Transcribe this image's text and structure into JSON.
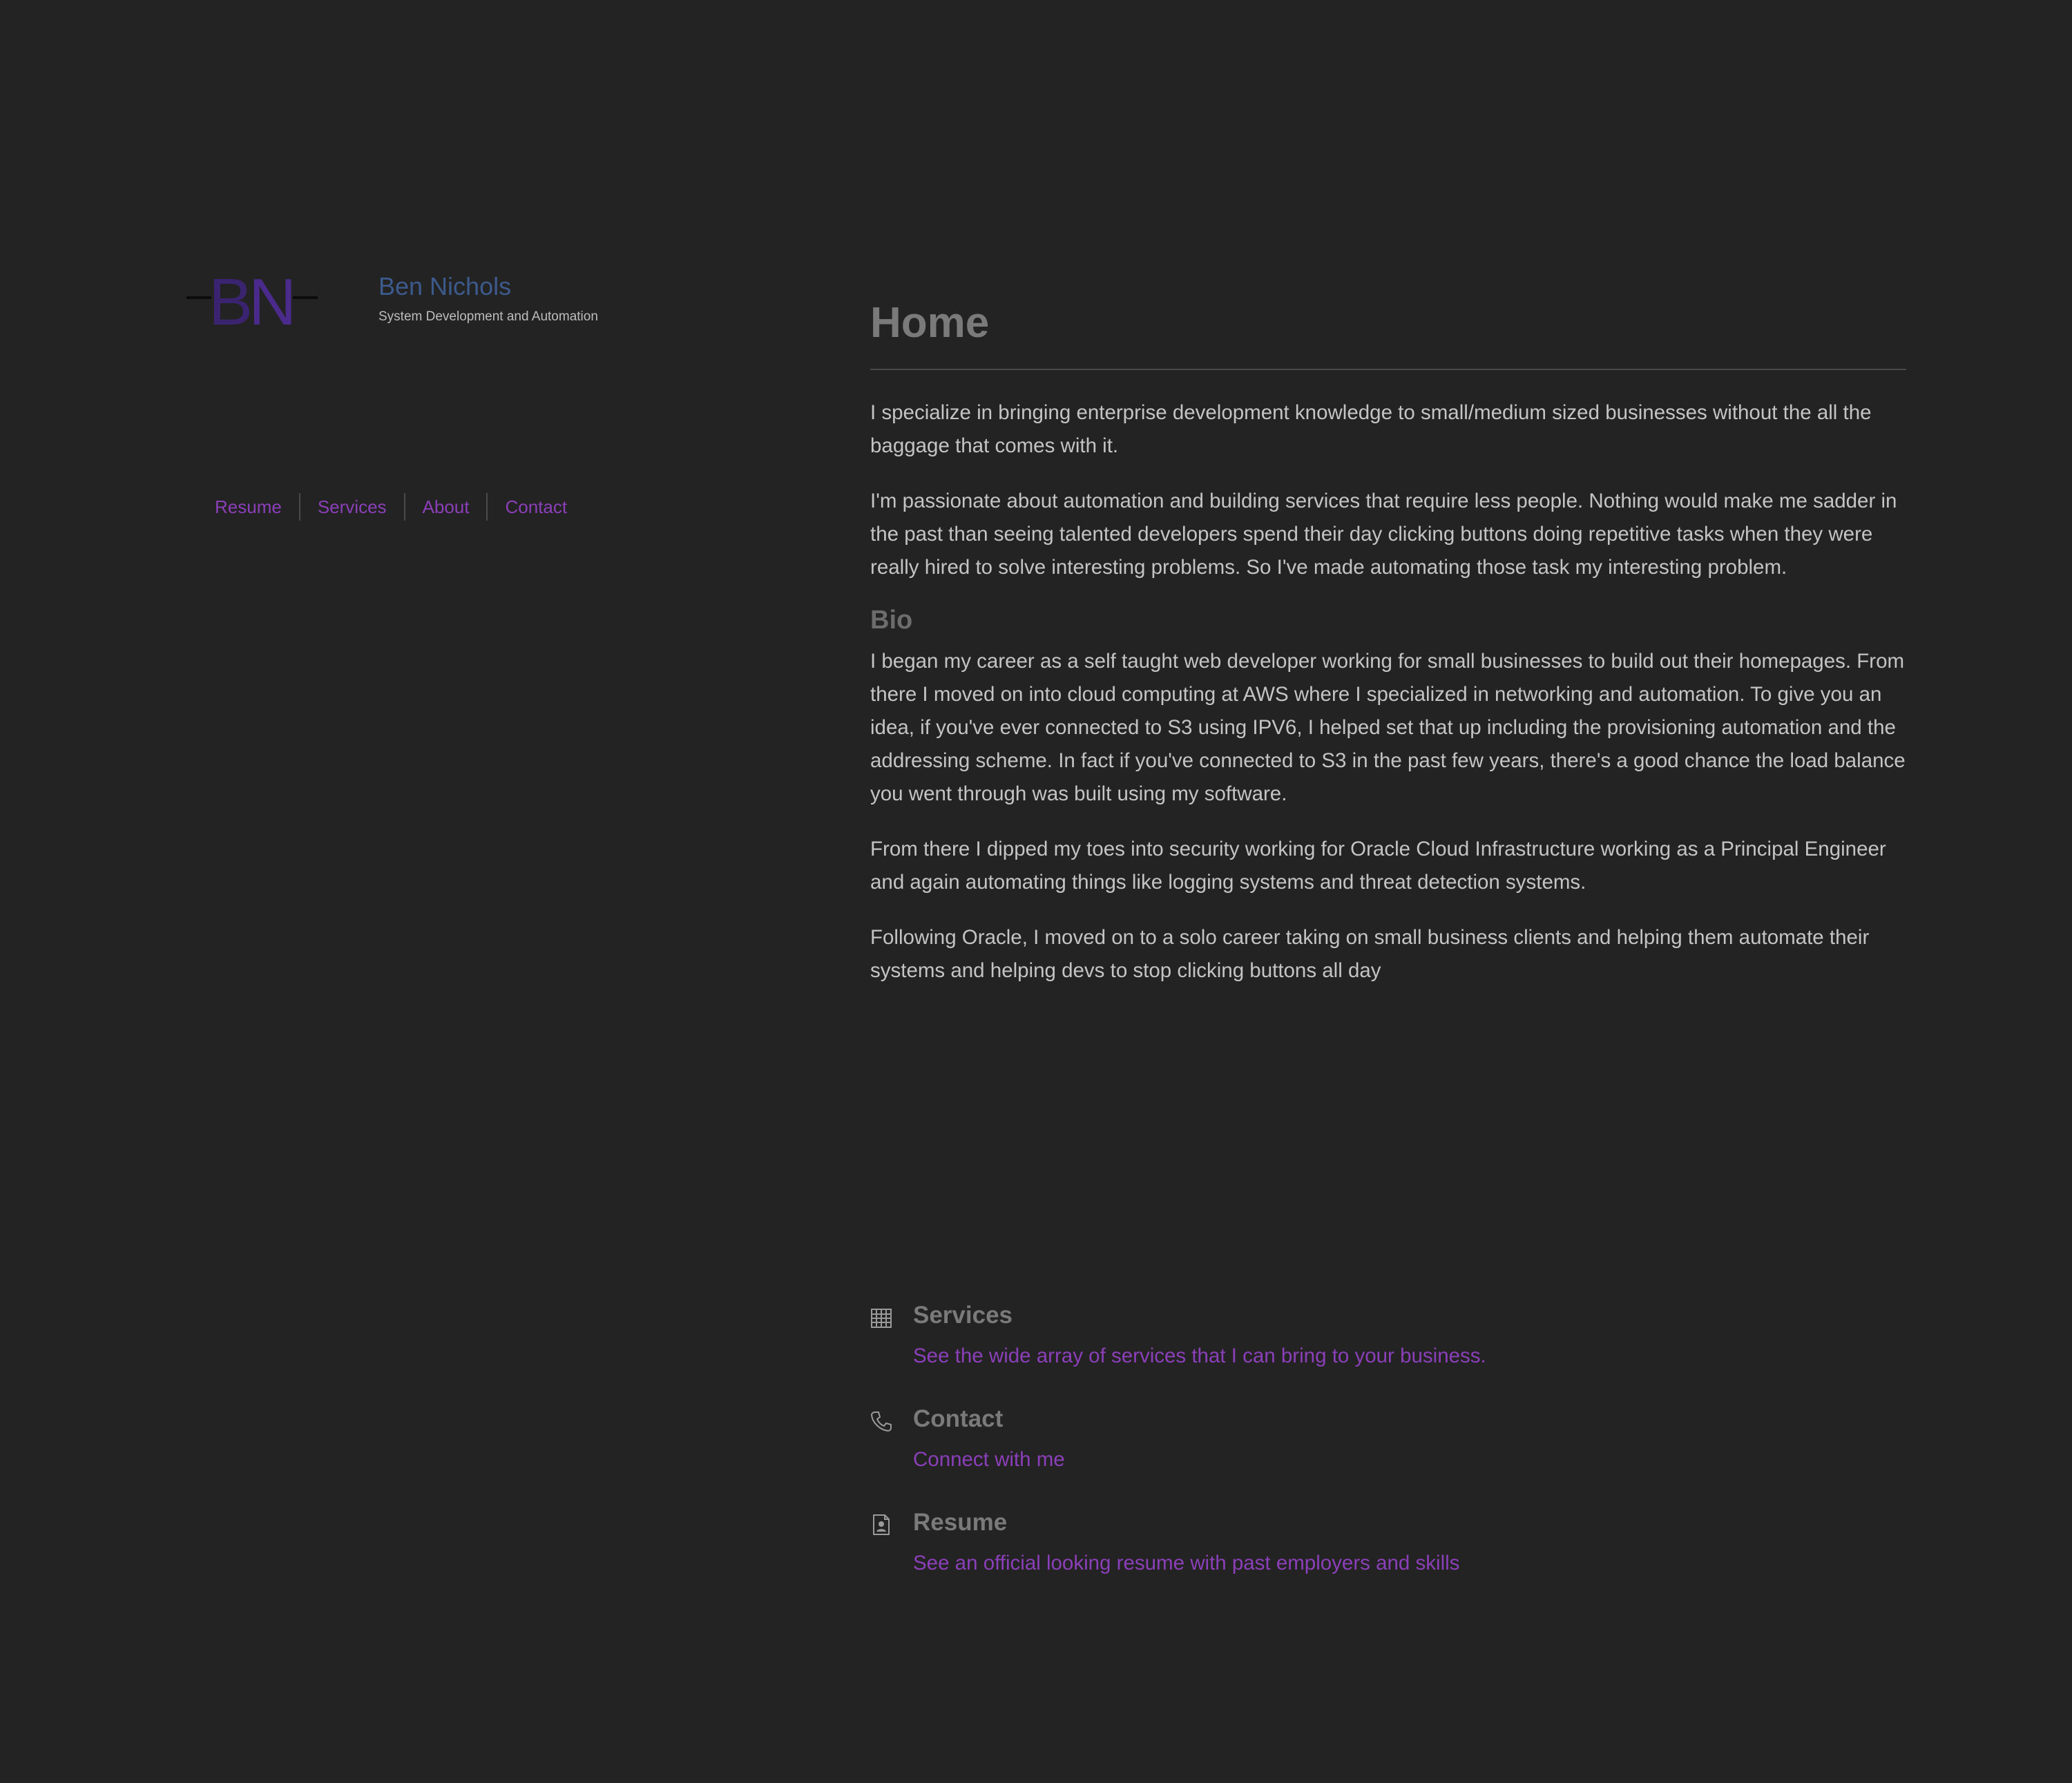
{
  "brand": {
    "logo_icon": "bn-monogram-logo",
    "title": "Ben Nichols",
    "tagline": "System Development and Automation"
  },
  "nav": {
    "items": [
      {
        "label": "Resume"
      },
      {
        "label": "Services"
      },
      {
        "label": "About"
      },
      {
        "label": "Contact"
      }
    ]
  },
  "main": {
    "title": "Home",
    "intro": [
      "I specialize in bringing enterprise development knowledge to small/medium sized businesses without the all the baggage that comes with it.",
      "I'm passionate about automation and building services that require less people. Nothing would make me sadder in the past than seeing talented developers spend their day clicking buttons doing repetitive tasks when they were really hired to solve interesting problems. So I've made automating those task my interesting problem."
    ],
    "bio_heading": "Bio",
    "bio": [
      "I began my career as a self taught web developer working for small businesses to build out their homepages. From there I moved on into cloud computing at AWS where I specialized in networking and automation. To give you an idea, if you've ever connected to S3 using IPV6, I helped set that up including the provisioning automation and the addressing scheme. In fact if you've connected to S3 in the past few years, there's a good chance the load balance you went through was built using my software.",
      "From there I dipped my toes into security working for Oracle Cloud Infrastructure working as a Principal Engineer and again automating things like logging systems and threat detection systems.",
      "Following Oracle, I moved on to a solo career taking on small business clients and helping them automate their systems and helping devs to stop clicking buttons all day"
    ]
  },
  "features": [
    {
      "icon": "building-icon",
      "title": "Services",
      "link": "See the wide array of services that I can bring to your business."
    },
    {
      "icon": "phone-icon",
      "title": "Contact",
      "link": "Connect with me"
    },
    {
      "icon": "resume-document-icon",
      "title": "Resume",
      "link": "See an official looking resume with past employers and skills"
    }
  ],
  "colors": {
    "background": "#232323",
    "accent_link": "#8b3fb8",
    "brand_title": "#3c5a8c",
    "logo_purple": "#4a2a8a"
  }
}
